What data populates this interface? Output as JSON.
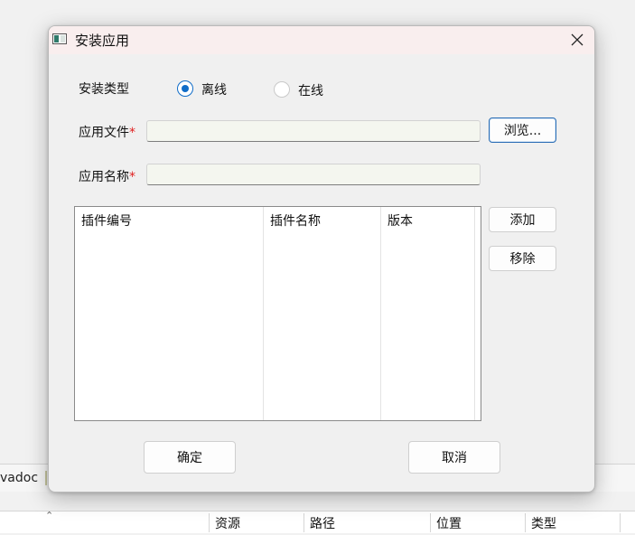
{
  "dialog": {
    "title": "安装应用",
    "type_label": "安装类型",
    "radios": [
      {
        "label": "离线",
        "checked": true
      },
      {
        "label": "在线",
        "checked": false
      }
    ],
    "file_label": "应用文件",
    "name_label": "应用名称",
    "required_mark": "*",
    "file_value": "",
    "name_value": "",
    "browse_label": "浏览...",
    "add_label": "添加",
    "remove_label": "移除",
    "table_columns": [
      "插件编号",
      "插件名称",
      "版本"
    ],
    "ok_label": "确定",
    "cancel_label": "取消"
  },
  "background": {
    "text": "vadoc",
    "columns": [
      "资源",
      "路径",
      "位置",
      "类型"
    ]
  },
  "colors": {
    "accent": "#0f6cc8",
    "required": "#e02020",
    "titlebar": "#f9eeee"
  }
}
